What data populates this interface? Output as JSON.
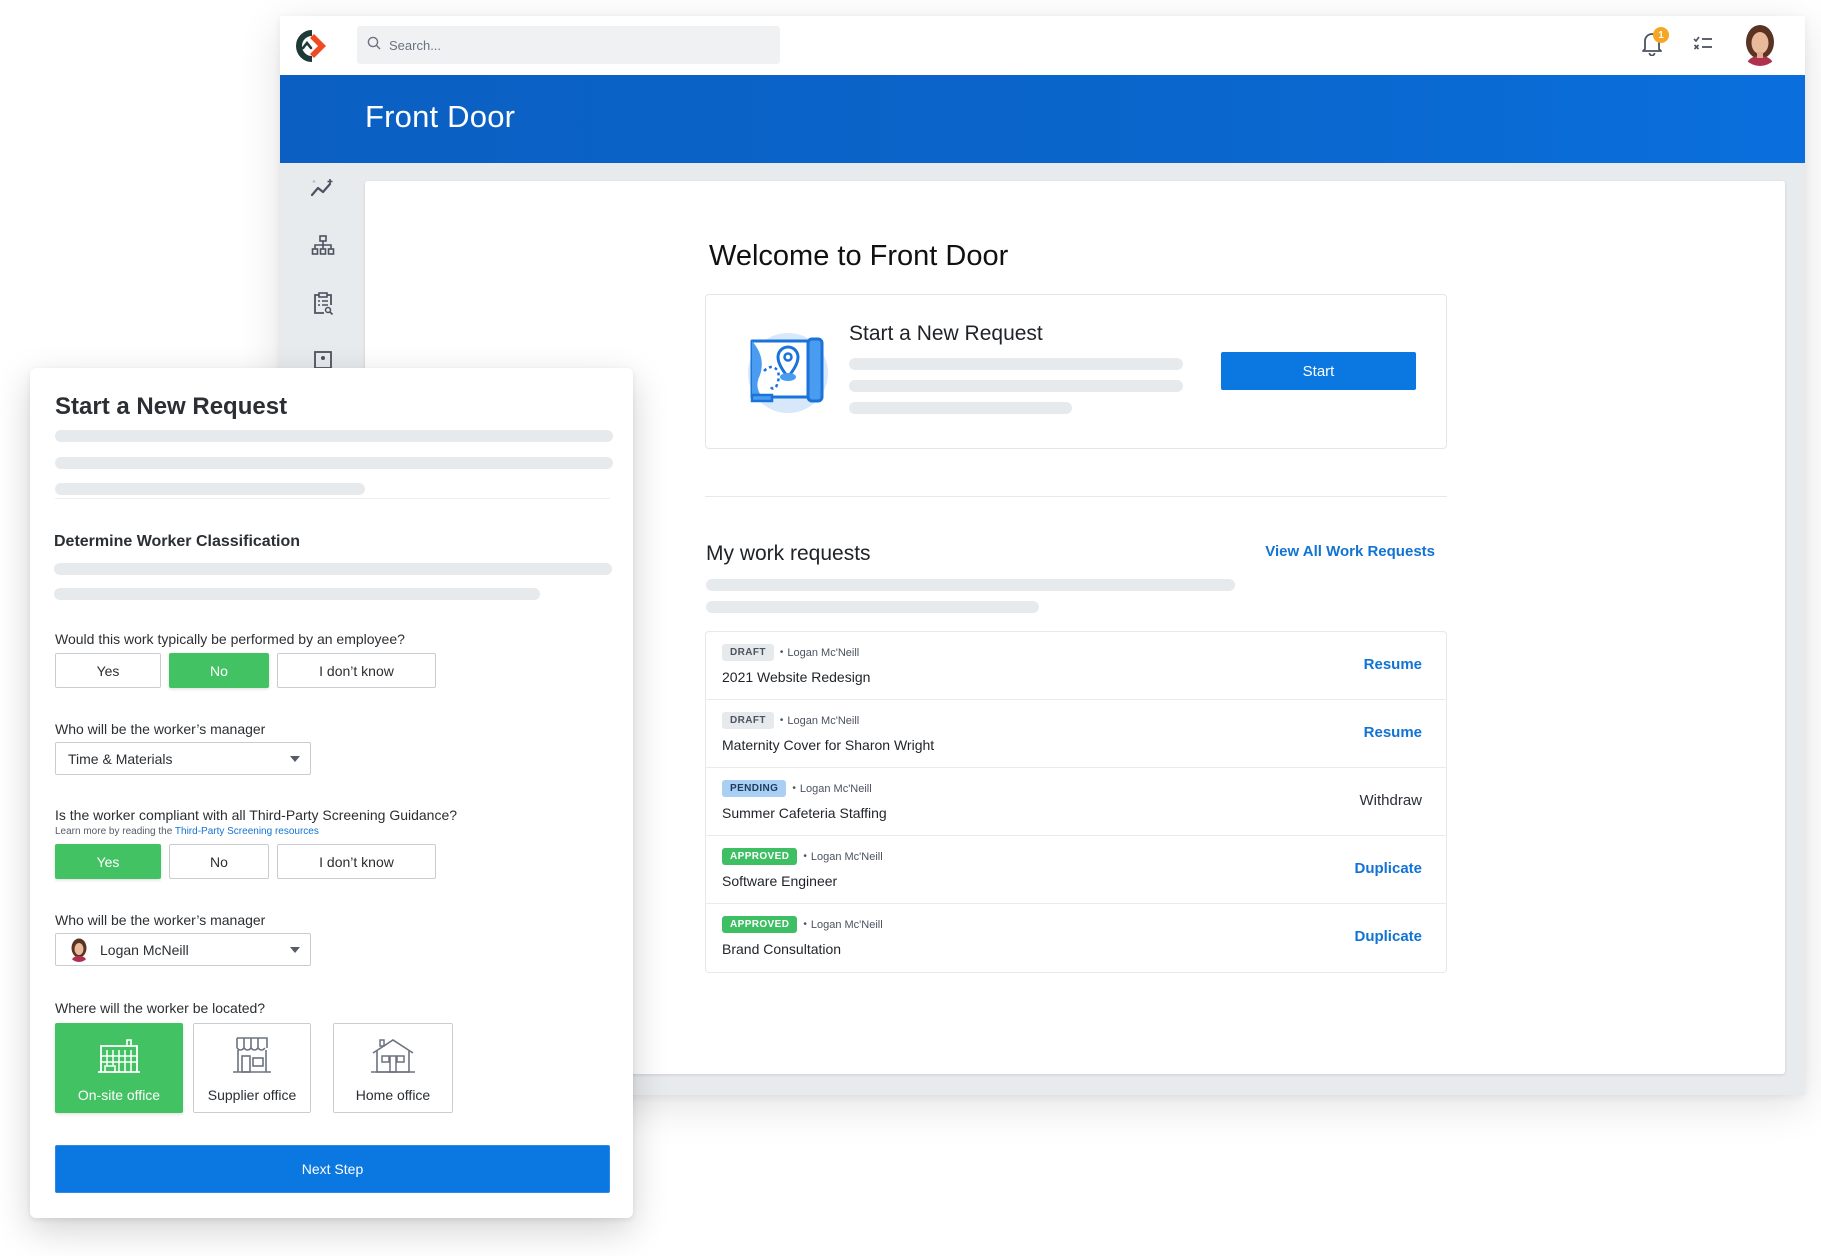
{
  "app": {
    "search_placeholder": "Search...",
    "notification_count": "1",
    "banner_title": "Front Door",
    "sidebar_items": [
      {
        "icon": "trending-analytics-icon"
      },
      {
        "icon": "org-chart-icon"
      },
      {
        "icon": "clipboard-search-icon"
      },
      {
        "icon": "id-card-icon"
      }
    ]
  },
  "main": {
    "welcome_title": "Welcome to Front Door",
    "start_card": {
      "title": "Start a New Request",
      "button_label": "Start"
    },
    "work_requests": {
      "title": "My work requests",
      "view_all_label": "View All Work Requests",
      "items": [
        {
          "status": "DRAFT",
          "status_type": "draft",
          "owner": "Logan Mc'Neill",
          "name": "2021 Website Redesign",
          "action": "Resume",
          "action_style": "link"
        },
        {
          "status": "DRAFT",
          "status_type": "draft",
          "owner": "Logan Mc'Neill",
          "name": "Maternity Cover for Sharon Wright",
          "action": "Resume",
          "action_style": "link"
        },
        {
          "status": "PENDING",
          "status_type": "pending",
          "owner": "Logan Mc'Neill",
          "name": "Summer Cafeteria Staffing",
          "action": "Withdraw",
          "action_style": "neutral"
        },
        {
          "status": "APPROVED",
          "status_type": "approved",
          "owner": "Logan Mc'Neill",
          "name": "Software Engineer",
          "action": "Duplicate",
          "action_style": "link"
        },
        {
          "status": "APPROVED",
          "status_type": "approved",
          "owner": "Logan Mc'Neill",
          "name": "Brand Consultation",
          "action": "Duplicate",
          "action_style": "link"
        }
      ]
    }
  },
  "form": {
    "title": "Start a New Request",
    "section_title": "Determine Worker Classification",
    "q1": {
      "label": "Would this work typically be performed by an employee?",
      "options": [
        "Yes",
        "No",
        "I don’t know"
      ],
      "selected": "No"
    },
    "q2": {
      "label": "Who will be the worker’s manager",
      "value": "Time & Materials"
    },
    "q3": {
      "label": "Is the worker compliant with all Third-Party Screening Guidance?",
      "sub_prefix": "Learn more by reading the ",
      "sub_link": "Third-Party Screening resources",
      "options": [
        "Yes",
        "No",
        "I don’t know"
      ],
      "selected": "Yes"
    },
    "q4": {
      "label": "Who will be the worker’s manager",
      "value": "Logan McNeill"
    },
    "q5": {
      "label": "Where will the worker be located?",
      "options": [
        "On-site office",
        "Supplier office",
        "Home office"
      ],
      "selected": "On-site office"
    },
    "next_label": "Next Step"
  },
  "colors": {
    "brand_blue": "#0a66cc",
    "primary_button": "#0b77e0",
    "link": "#1173d4",
    "selected_green": "#43c263",
    "badge_orange": "#f5a623",
    "logo_dark": "#1d3a36",
    "logo_red": "#f04a23"
  }
}
